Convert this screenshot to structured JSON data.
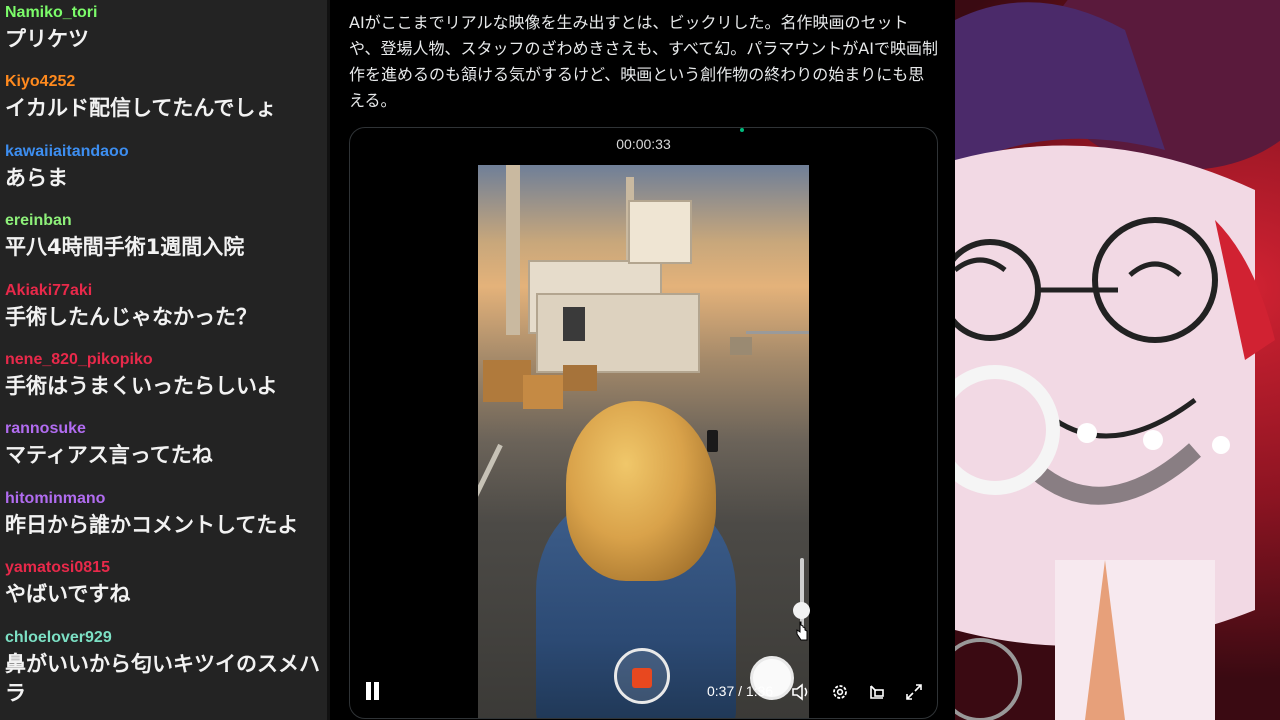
{
  "chat": {
    "messages": [
      {
        "user": "Namiko_tori",
        "color": "#7cfc6a",
        "text": "プリケツ"
      },
      {
        "user": "Kiyo4252",
        "color": "#ff8a1e",
        "text": "イカルド配信してたんでしょ"
      },
      {
        "user": "kawaiiaitandaoo",
        "color": "#3d8ef0",
        "text": "あらま"
      },
      {
        "user": "ereinban",
        "color": "#8ef07a",
        "text": "平八4時間手術1週間入院"
      },
      {
        "user": "Akiaki77aki",
        "color": "#e8294a",
        "text": "手術したんじゃなかった？"
      },
      {
        "user": "nene_820_pikopiko",
        "color": "#e8294a",
        "text": "手術はうまくいったらしいよ"
      },
      {
        "user": "rannosuke",
        "color": "#b16cf0",
        "text": "マティアス言ってたね"
      },
      {
        "user": "hitominmano",
        "color": "#b16cf0",
        "text": "昨日から誰かコメントしてたよ"
      },
      {
        "user": "yamatosi0815",
        "color": "#e8294a",
        "text": "やばいですね"
      },
      {
        "user": "chloelover929",
        "color": "#7ce0c4",
        "text": "鼻がいいから匂いキツイのスメハラ"
      }
    ]
  },
  "post": {
    "text": "AIがここまでリアルな映像を生み出すとは、ビックリした。名作映画のセットや、登場人物、スタッフのざわめきさえも、すべて幻。パラマウントがAIで映画制作を進めるのも頷ける気がするけど、映画という創作物の終わりの始まりにも思える。"
  },
  "video": {
    "timestamp": "00:00:33",
    "time_readout": "0:37 / 1:36",
    "volume": 0.35,
    "record_color": "#e8481f",
    "icons": {
      "pause": "pause-icon",
      "record": "record-icon",
      "mute": "speaker-icon",
      "settings": "gear-icon",
      "pip": "pip-icon",
      "fullscreen": "fullscreen-icon"
    }
  },
  "colors": {
    "chat_bg": "#232323",
    "post_bg": "#000000",
    "art_red": "#d12232"
  }
}
